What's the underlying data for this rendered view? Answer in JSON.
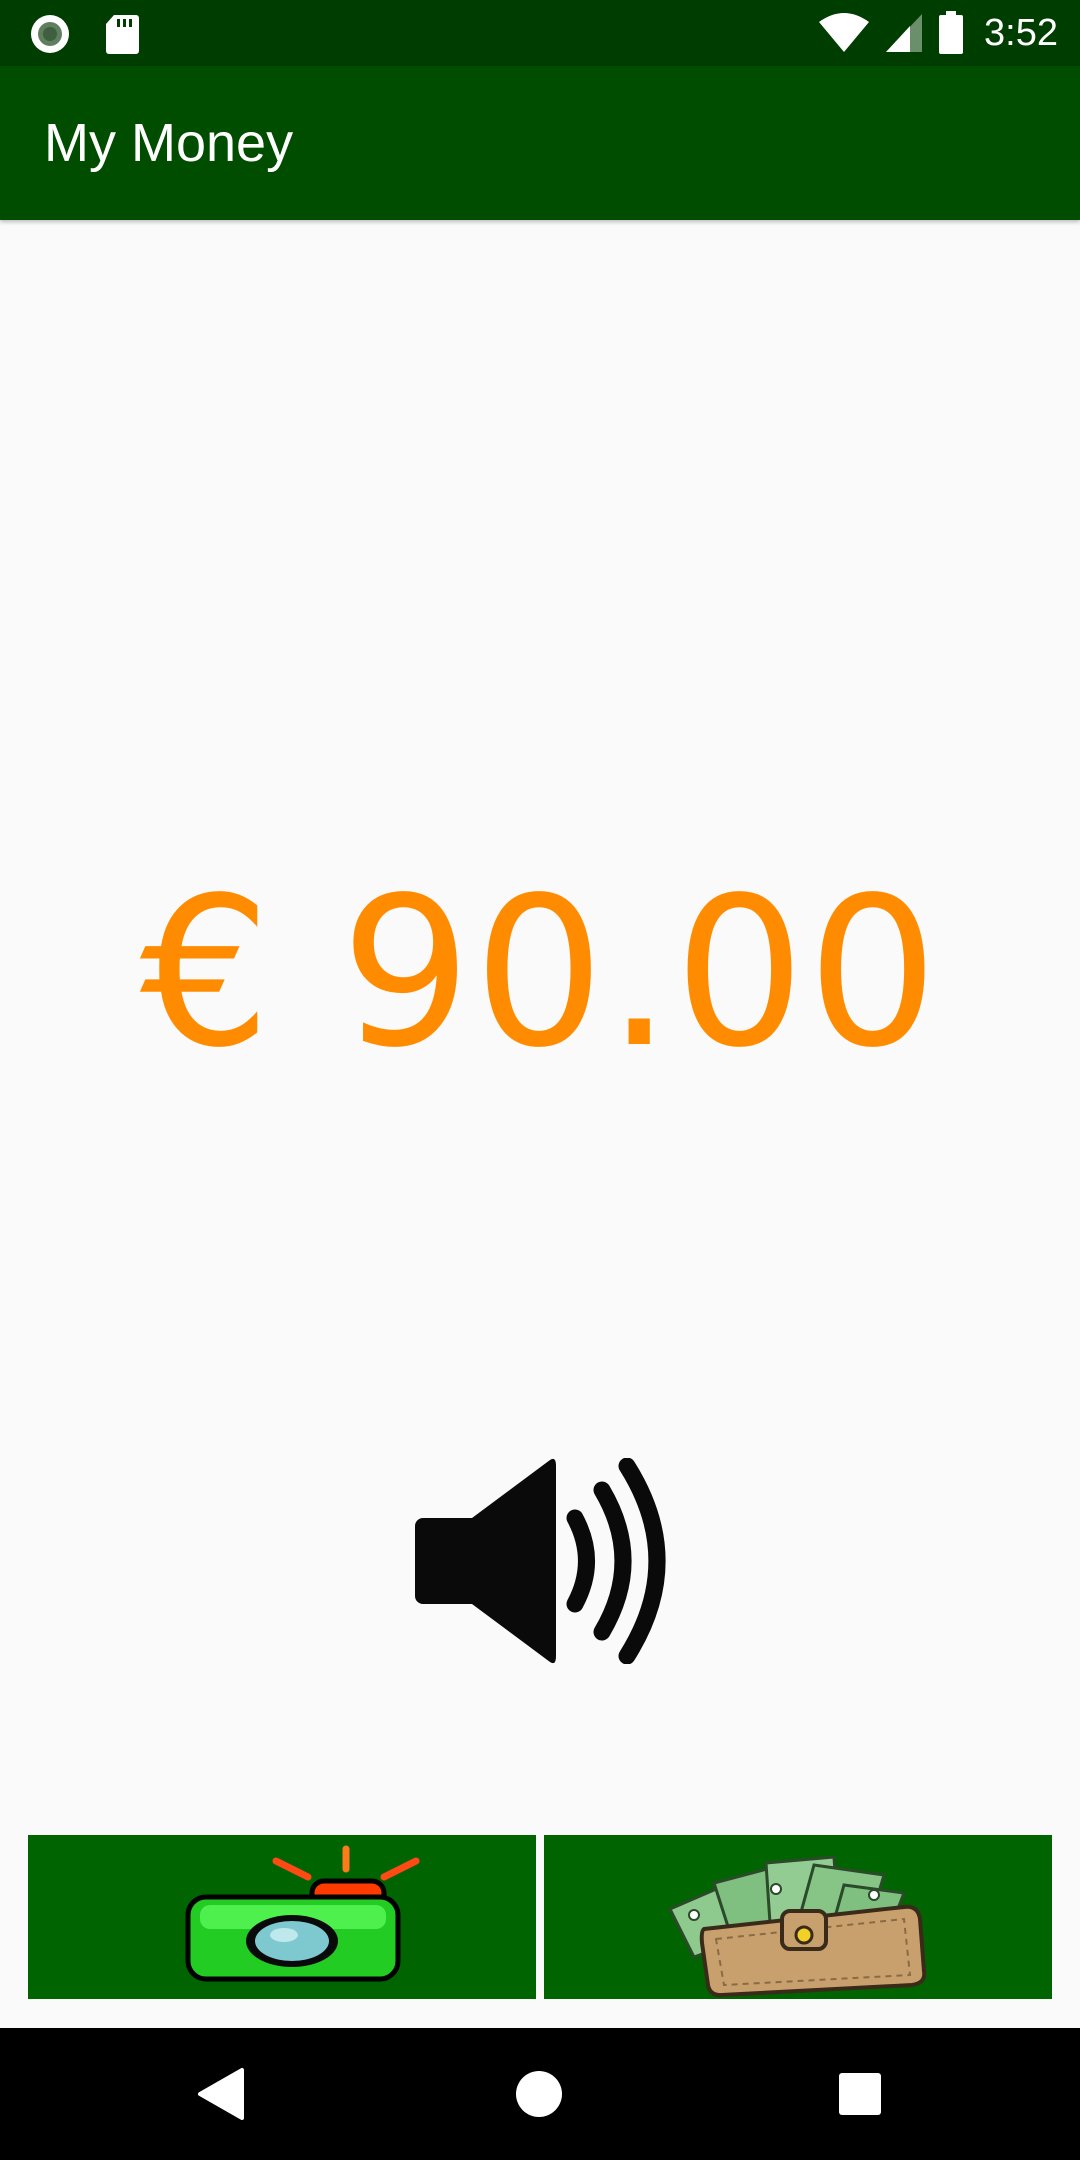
{
  "status_bar": {
    "time": "3:52",
    "left_icons": [
      "notification-dot-icon",
      "sd-card-icon"
    ],
    "right_icons": [
      "wifi-icon",
      "cell-signal-icon",
      "battery-icon"
    ]
  },
  "app_bar": {
    "title": "My Money",
    "color": "#004d00"
  },
  "main": {
    "amount": "€ 90.00",
    "amount_color": "#ff8c00",
    "speaker_icon": "speaker-volume-icon"
  },
  "actions": {
    "camera_icon": "camera-icon",
    "wallet_icon": "wallet-icon",
    "button_color": "#006400"
  },
  "nav_bar": {
    "icons": [
      "back-icon",
      "home-icon",
      "recents-icon"
    ]
  }
}
